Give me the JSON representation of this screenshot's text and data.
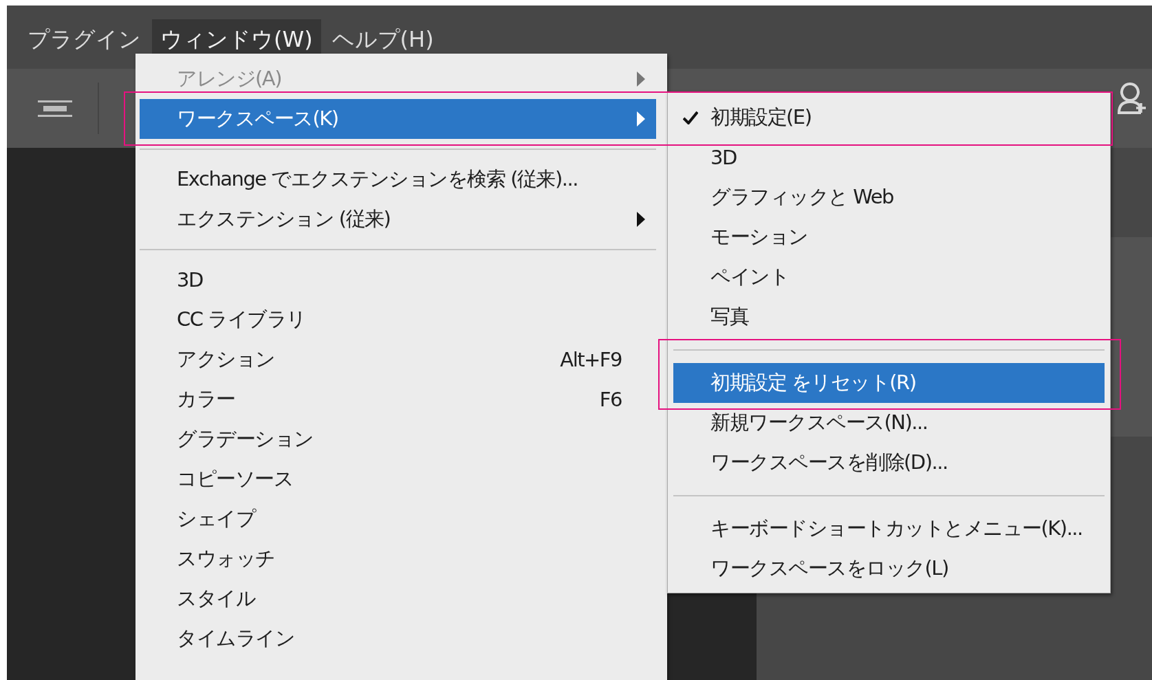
{
  "menubar": [
    {
      "label": "プラグイン",
      "selected": false
    },
    {
      "label": "ウィンドウ(W)",
      "selected": true
    },
    {
      "label": "ヘルプ(H)",
      "selected": false
    }
  ],
  "window_menu": [
    {
      "kind": "item",
      "label": "アレンジ(A)",
      "disabled": true,
      "has_submenu": true,
      "selected": false
    },
    {
      "kind": "item",
      "label": "ワークスペース(K)",
      "disabled": false,
      "has_submenu": true,
      "selected": true
    },
    {
      "kind": "separator"
    },
    {
      "kind": "item",
      "label": "Exchange でエクステンションを検索 (従来)...",
      "disabled": false,
      "has_submenu": false,
      "selected": false
    },
    {
      "kind": "item",
      "label": "エクステンション (従来)",
      "disabled": false,
      "has_submenu": true,
      "selected": false
    },
    {
      "kind": "separator"
    },
    {
      "kind": "item",
      "label": "3D",
      "disabled": false,
      "has_submenu": false,
      "selected": false
    },
    {
      "kind": "item",
      "label": "CC ライブラリ",
      "disabled": false,
      "has_submenu": false,
      "selected": false
    },
    {
      "kind": "item",
      "label": "アクション",
      "shortcut": "Alt+F9",
      "disabled": false,
      "has_submenu": false,
      "selected": false
    },
    {
      "kind": "item",
      "label": "カラー",
      "shortcut": "F6",
      "disabled": false,
      "has_submenu": false,
      "selected": false
    },
    {
      "kind": "item",
      "label": "グラデーション",
      "disabled": false,
      "has_submenu": false,
      "selected": false
    },
    {
      "kind": "item",
      "label": "コピーソース",
      "disabled": false,
      "has_submenu": false,
      "selected": false
    },
    {
      "kind": "item",
      "label": "シェイプ",
      "disabled": false,
      "has_submenu": false,
      "selected": false
    },
    {
      "kind": "item",
      "label": "スウォッチ",
      "disabled": false,
      "has_submenu": false,
      "selected": false
    },
    {
      "kind": "item",
      "label": "スタイル",
      "disabled": false,
      "has_submenu": false,
      "selected": false
    },
    {
      "kind": "item",
      "label": "タイムライン",
      "disabled": false,
      "has_submenu": false,
      "selected": false
    }
  ],
  "workspace_submenu": [
    {
      "kind": "item",
      "label": "初期設定(E)",
      "checked": true,
      "selected": false
    },
    {
      "kind": "item",
      "label": "3D",
      "checked": false,
      "selected": false
    },
    {
      "kind": "item",
      "label": "グラフィックと Web",
      "checked": false,
      "selected": false
    },
    {
      "kind": "item",
      "label": "モーション",
      "checked": false,
      "selected": false
    },
    {
      "kind": "item",
      "label": "ペイント",
      "checked": false,
      "selected": false
    },
    {
      "kind": "item",
      "label": "写真",
      "checked": false,
      "selected": false
    },
    {
      "kind": "separator"
    },
    {
      "kind": "item",
      "label": "初期設定 をリセット(R)",
      "checked": false,
      "selected": true
    },
    {
      "kind": "item",
      "label": "新規ワークスペース(N)...",
      "checked": false,
      "selected": false
    },
    {
      "kind": "item",
      "label": "ワークスペースを削除(D)...",
      "checked": false,
      "selected": false
    },
    {
      "kind": "separator"
    },
    {
      "kind": "item",
      "label": "キーボードショートカットとメニュー(K)...",
      "checked": false,
      "selected": false
    },
    {
      "kind": "item",
      "label": "ワークスペースをロック(L)",
      "checked": false,
      "selected": false
    }
  ]
}
